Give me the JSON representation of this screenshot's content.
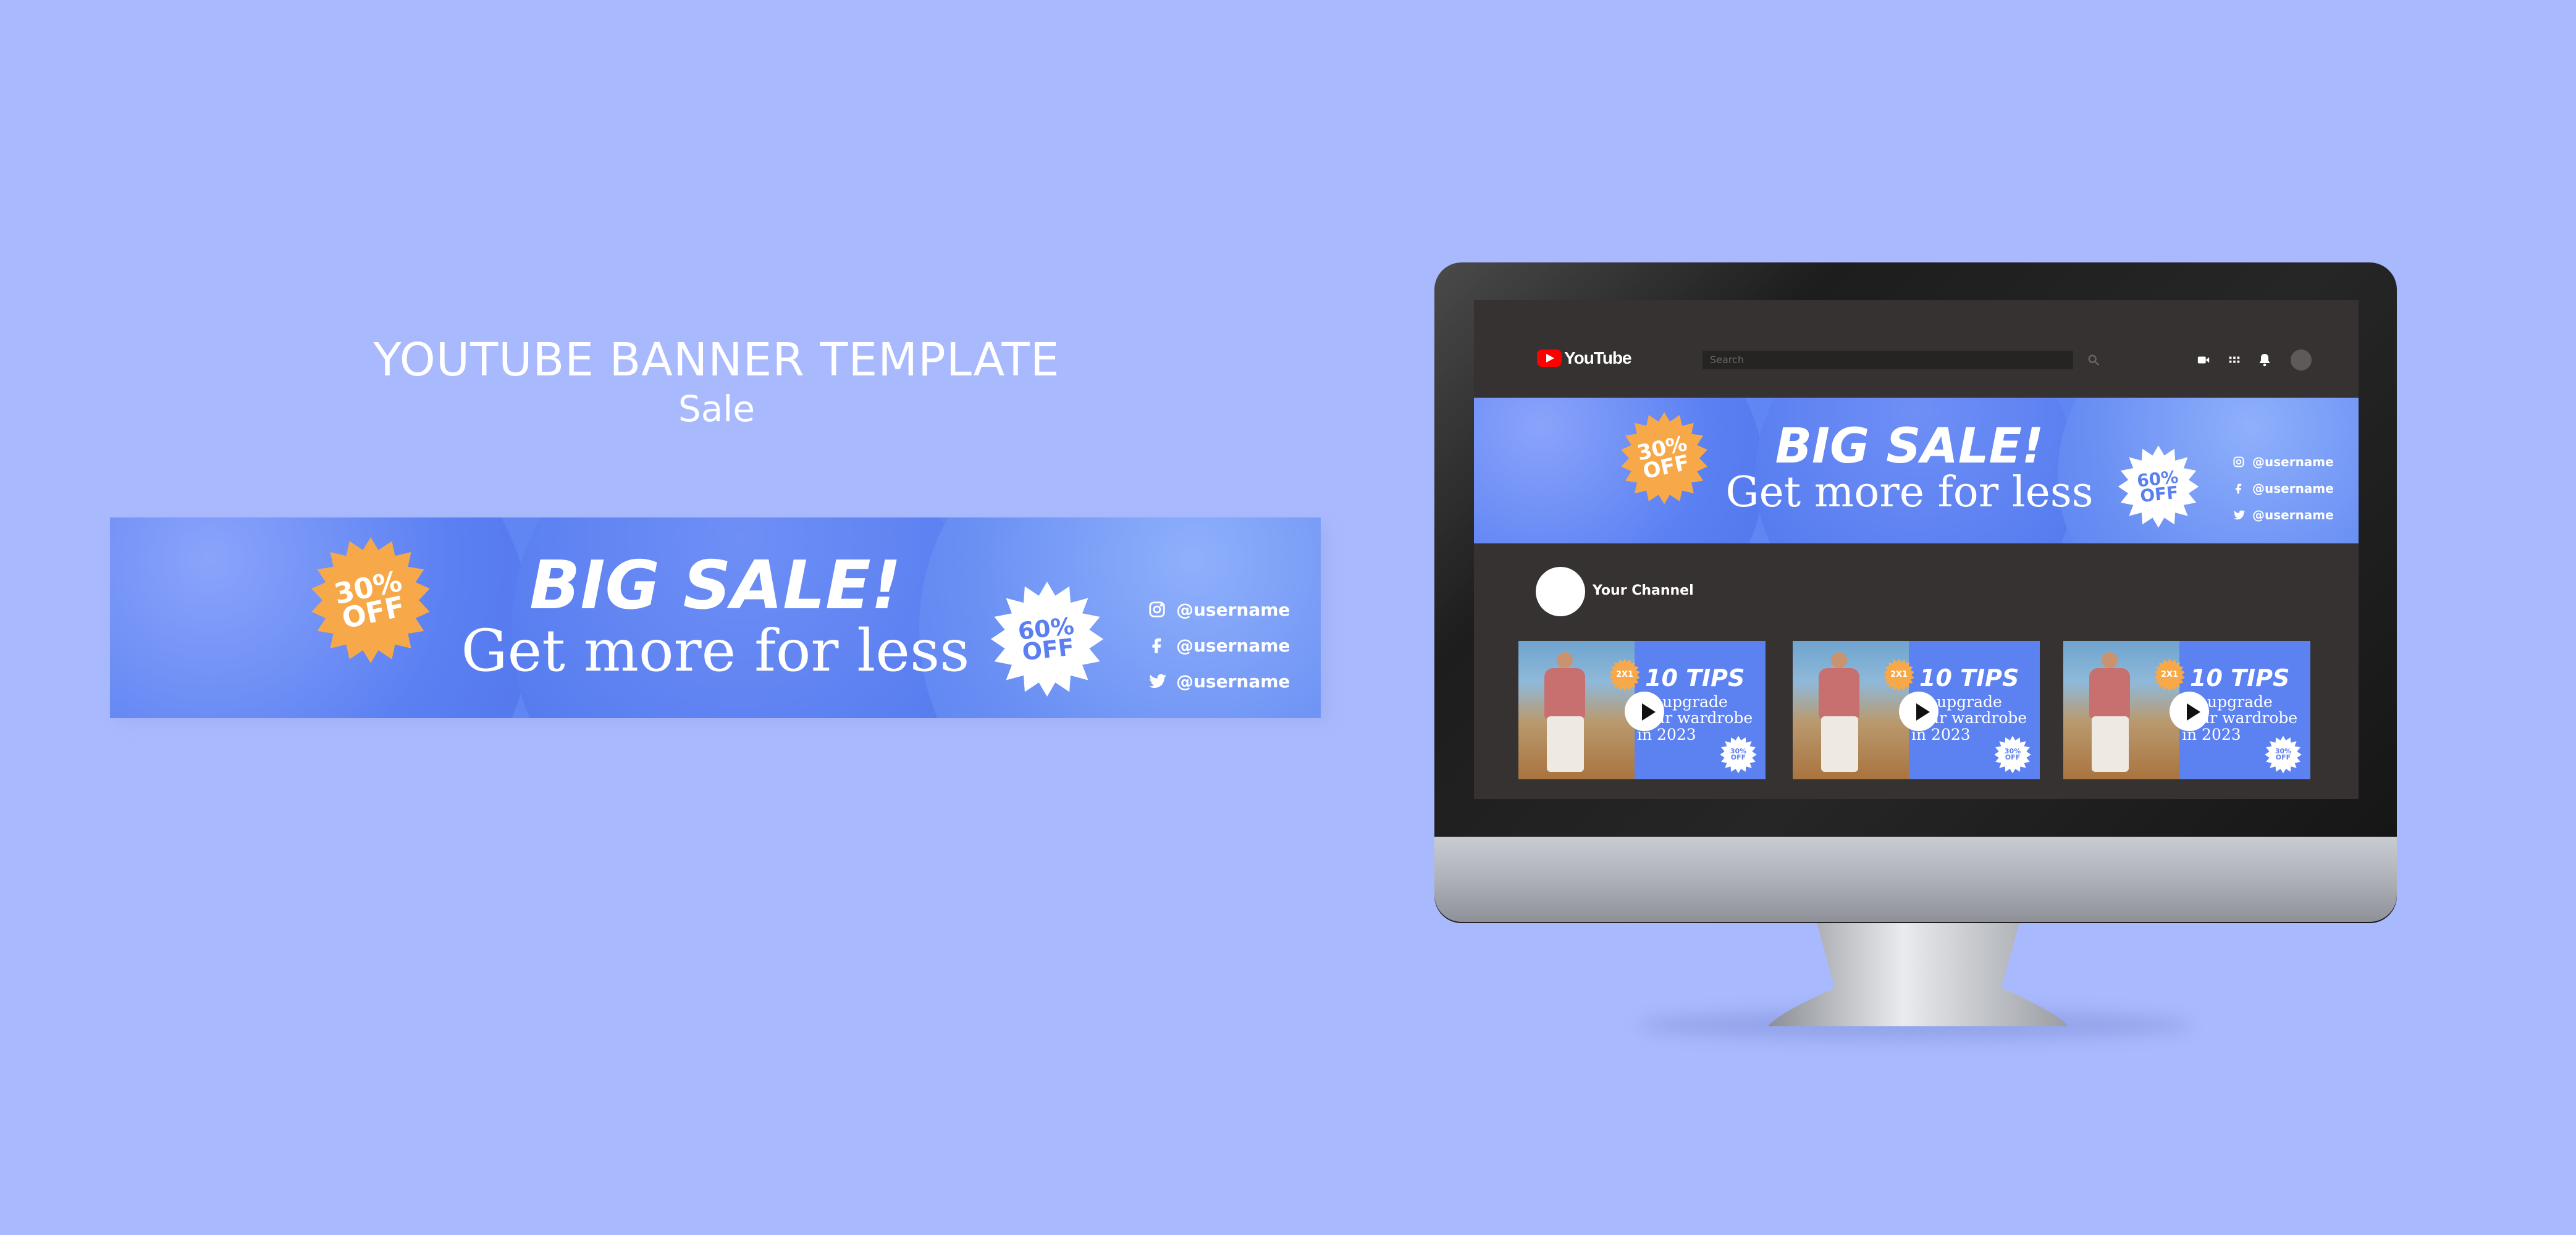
{
  "hero": {
    "title": "YOUTUBE BANNER TEMPLATE",
    "subtitle": "Sale"
  },
  "banner": {
    "badge_left": {
      "line1": "30%",
      "line2": "OFF"
    },
    "title": "BIG SALE!",
    "tagline": "Get more for less",
    "badge_right": {
      "line1": "60%",
      "line2": "OFF"
    },
    "socials": [
      {
        "icon": "instagram-icon",
        "handle": "@username"
      },
      {
        "icon": "facebook-icon",
        "handle": "@username"
      },
      {
        "icon": "twitter-icon",
        "handle": "@username"
      }
    ]
  },
  "youtube": {
    "logo_text": "YouTube",
    "search_placeholder": "Search",
    "channel_name": "Your Channel",
    "header_icons": [
      "create-video-icon",
      "apps-grid-icon",
      "bell-icon",
      "account-avatar-icon"
    ]
  },
  "videos": [
    {
      "title": "10 TIPS",
      "line1": "to upgrade",
      "line2": "your wardrobe",
      "line3": "in 2023",
      "badge1": "2X1",
      "badge2": "30% OFF"
    },
    {
      "title": "10 TIPS",
      "line1": "to upgrade",
      "line2": "your wardrobe",
      "line3": "in 2023",
      "badge1": "2X1",
      "badge2": "30% OFF"
    },
    {
      "title": "10 TIPS",
      "line1": "to upgrade",
      "line2": "your wardrobe",
      "line3": "in 2023",
      "badge1": "2X1",
      "badge2": "30% OFF"
    }
  ],
  "colors": {
    "background": "#a9b9fd",
    "banner_blue": "#5f86f3",
    "badge_orange": "#f7a94a",
    "youtube_red": "#ff0000",
    "screen_dark": "#363232"
  }
}
